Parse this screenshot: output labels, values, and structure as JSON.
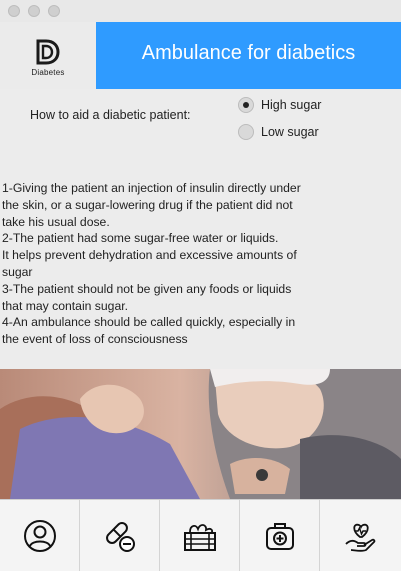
{
  "window": {
    "controls": [
      "close",
      "minimize",
      "zoom"
    ]
  },
  "header": {
    "logo_text": "Diabetes",
    "title": "Ambulance for diabetics",
    "banner_color": "#2f9bff"
  },
  "form": {
    "question": "How to aid a diabetic patient:",
    "options": [
      {
        "label": "High sugar",
        "selected": true
      },
      {
        "label": "Low sugar",
        "selected": false
      }
    ]
  },
  "instructions": [
    "1-Giving the patient an injection of insulin directly under",
    " the skin, or a sugar-lowering drug if the patient did not",
    " take his usual dose.",
    "2-The patient had some sugar-free water or liquids.",
    "It helps prevent dehydration and excessive amounts of",
    "sugar",
    "3-The patient should not be given any foods or liquids",
    " that may contain sugar.",
    "4-An ambulance should be called quickly, especially in",
    " the event of loss of consciousness"
  ],
  "tabs": [
    {
      "icon": "user-icon"
    },
    {
      "icon": "pills-icon"
    },
    {
      "icon": "food-crate-icon"
    },
    {
      "icon": "medical-kit-icon"
    },
    {
      "icon": "heart-hand-icon"
    }
  ]
}
